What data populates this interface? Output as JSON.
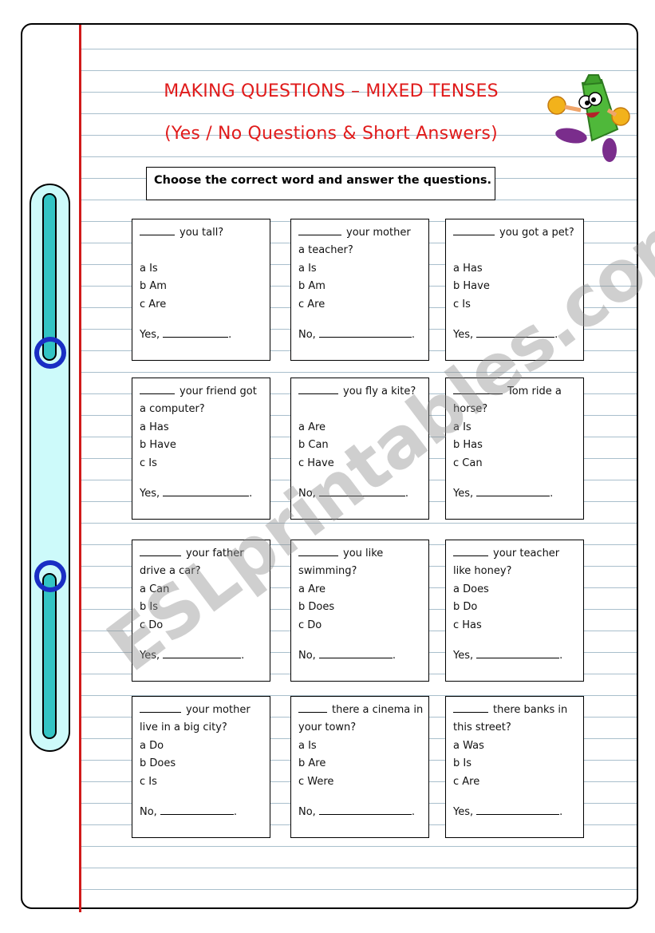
{
  "header": {
    "title": "MAKING QUESTIONS – MIXED TENSES",
    "subtitle": "(Yes / No Questions & Short Answers)"
  },
  "instructions": "Choose the correct word and answer the questions.",
  "mascot_icon": "running-marker-cartoon",
  "watermark": "ESLprintables.com",
  "colors": {
    "title": "#e01b1b",
    "margin_line": "#d11a1a",
    "ruled_line": "#a9bfcc",
    "binder_fill": "#cdfafa",
    "binder_bar": "#33c4c4",
    "binder_ring": "#1a2ec4"
  },
  "questions": [
    {
      "line1": "you tall?",
      "line2": "",
      "options": [
        "a Is",
        "b Am",
        "c Are"
      ],
      "answer_prefix": "Yes,"
    },
    {
      "line1": "your mother",
      "line2": "a teacher?",
      "options": [
        "a Is",
        "b Am",
        "c Are"
      ],
      "answer_prefix": "No,"
    },
    {
      "line1": "you got a pet?",
      "line2": "",
      "options": [
        "a Has",
        "b Have",
        "c Is"
      ],
      "answer_prefix": "Yes,"
    },
    {
      "line1": "your friend got",
      "line2": "a computer?",
      "options": [
        "a Has",
        "b Have",
        "c Is"
      ],
      "answer_prefix": "Yes,"
    },
    {
      "line1": "you fly a kite?",
      "line2": "",
      "options": [
        "a Are",
        "b Can",
        "c Have"
      ],
      "answer_prefix": "No,"
    },
    {
      "line1": "Tom ride a",
      "line2": "horse?",
      "options": [
        "a Is",
        "b Has",
        "c Can"
      ],
      "answer_prefix": "Yes,"
    },
    {
      "line1": "your father",
      "line2": "drive a car?",
      "options": [
        "a Can",
        "b Is",
        "c Do"
      ],
      "answer_prefix": "Yes,"
    },
    {
      "line1": "you like",
      "line2": "swimming?",
      "options": [
        "a Are",
        "b Does",
        "c Do"
      ],
      "answer_prefix": "No,"
    },
    {
      "line1": "your teacher",
      "line2": "like honey?",
      "options": [
        "a Does",
        "b Do",
        "c Has"
      ],
      "answer_prefix": "Yes,"
    },
    {
      "line1": "your mother",
      "line2": "live in a big city?",
      "options": [
        "a Do",
        "b Does",
        "c Is"
      ],
      "answer_prefix": "No,"
    },
    {
      "line1": "there a cinema in",
      "line2": "your town?",
      "options": [
        "a Is",
        "b Are",
        "c Were"
      ],
      "answer_prefix": "No,"
    },
    {
      "line1": "there banks in",
      "line2": "this street?",
      "options": [
        "a Was",
        "b Is",
        "c Are"
      ],
      "answer_prefix": "Yes,"
    }
  ]
}
